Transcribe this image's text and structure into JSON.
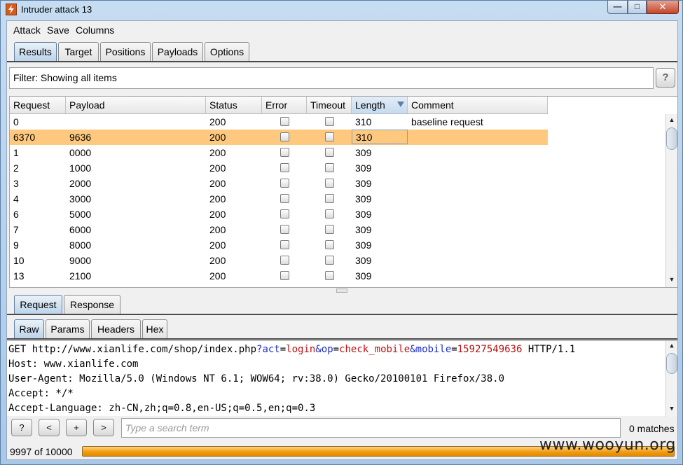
{
  "window": {
    "title": "Intruder attack 13"
  },
  "menu": [
    "Attack",
    "Save",
    "Columns"
  ],
  "main_tabs": [
    {
      "label": "Results",
      "active": true
    },
    {
      "label": "Target",
      "active": false
    },
    {
      "label": "Positions",
      "active": false
    },
    {
      "label": "Payloads",
      "active": false
    },
    {
      "label": "Options",
      "active": false
    }
  ],
  "filter": {
    "text": "Filter: Showing all items",
    "help_label": "?"
  },
  "table": {
    "columns": [
      "Request",
      "Payload",
      "Status",
      "Error",
      "Timeout",
      "Length",
      "Comment"
    ],
    "sorted_column": "Length",
    "rows": [
      {
        "request": "0",
        "payload": "",
        "status": "200",
        "error": false,
        "timeout": false,
        "length": "310",
        "comment": "baseline request",
        "selected": false
      },
      {
        "request": "6370",
        "payload": "9636",
        "status": "200",
        "error": false,
        "timeout": false,
        "length": "310",
        "comment": "",
        "selected": true
      },
      {
        "request": "1",
        "payload": "0000",
        "status": "200",
        "error": false,
        "timeout": false,
        "length": "309",
        "comment": "",
        "selected": false
      },
      {
        "request": "2",
        "payload": "1000",
        "status": "200",
        "error": false,
        "timeout": false,
        "length": "309",
        "comment": "",
        "selected": false
      },
      {
        "request": "3",
        "payload": "2000",
        "status": "200",
        "error": false,
        "timeout": false,
        "length": "309",
        "comment": "",
        "selected": false
      },
      {
        "request": "4",
        "payload": "3000",
        "status": "200",
        "error": false,
        "timeout": false,
        "length": "309",
        "comment": "",
        "selected": false
      },
      {
        "request": "6",
        "payload": "5000",
        "status": "200",
        "error": false,
        "timeout": false,
        "length": "309",
        "comment": "",
        "selected": false
      },
      {
        "request": "7",
        "payload": "6000",
        "status": "200",
        "error": false,
        "timeout": false,
        "length": "309",
        "comment": "",
        "selected": false
      },
      {
        "request": "9",
        "payload": "8000",
        "status": "200",
        "error": false,
        "timeout": false,
        "length": "309",
        "comment": "",
        "selected": false
      },
      {
        "request": "10",
        "payload": "9000",
        "status": "200",
        "error": false,
        "timeout": false,
        "length": "309",
        "comment": "",
        "selected": false
      },
      {
        "request": "13",
        "payload": "2100",
        "status": "200",
        "error": false,
        "timeout": false,
        "length": "309",
        "comment": "",
        "selected": false
      }
    ]
  },
  "detail_tabs": [
    {
      "label": "Request",
      "active": true
    },
    {
      "label": "Response",
      "active": false
    }
  ],
  "view_tabs": [
    {
      "label": "Raw",
      "active": true
    },
    {
      "label": "Params",
      "active": false
    },
    {
      "label": "Headers",
      "active": false
    },
    {
      "label": "Hex",
      "active": false
    }
  ],
  "request": {
    "line1": {
      "method_url": "GET http://www.xianlife.com/shop/index.php",
      "q": "?",
      "p1_name": "act",
      "eq": "=",
      "p1_value": "login",
      "amp": "&",
      "p2_name": "op",
      "p2_value": "check_mobile",
      "p3_name": "mobile",
      "p3_value": "15927549636",
      "proto": " HTTP/1.1"
    },
    "lines": [
      "Host: www.xianlife.com",
      "User-Agent: Mozilla/5.0 (Windows NT 6.1; WOW64; rv:38.0) Gecko/20100101 Firefox/38.0",
      "Accept: */*",
      "Accept-Language: zh-CN,zh;q=0.8,en-US;q=0.5,en;q=0.3"
    ]
  },
  "search": {
    "help_label": "?",
    "prev_label": "<",
    "add_label": "+",
    "next_label": ">",
    "placeholder": "Type a search term",
    "value": "",
    "matches": "0 matches"
  },
  "progress": {
    "label": "9997 of 10000",
    "fraction": 0.9997
  },
  "watermark": "www.wooyun.org",
  "colors": {
    "selected_row": "#fec97f",
    "progress": "#f29c11",
    "param_name": "#1b2fc9",
    "param_value": "#bb1010"
  }
}
